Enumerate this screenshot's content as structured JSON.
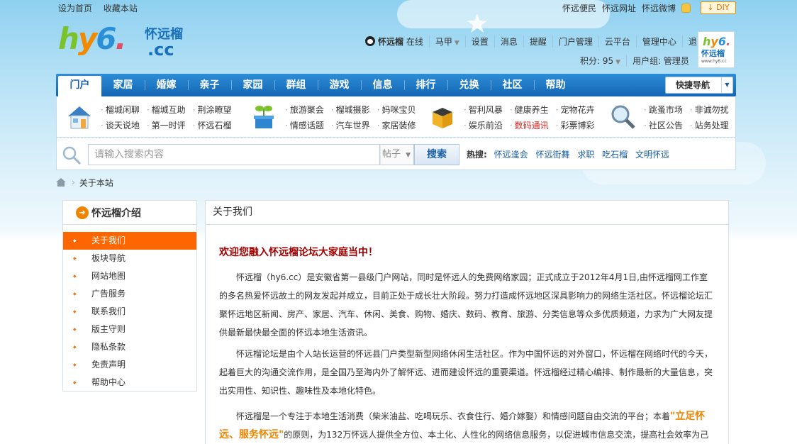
{
  "topbar": {
    "set_home": "设为首页",
    "bookmark": "收藏本站",
    "links": [
      "怀远便民",
      "怀远网址",
      "怀远微博"
    ],
    "diy": "DIY"
  },
  "logo": {
    "hy": [
      "h",
      "y",
      "6",
      "."
    ],
    "cn": "怀远榴",
    "cc": ".cc"
  },
  "user": {
    "name": "怀远榴",
    "status": "在线",
    "group_menu": "马甲",
    "links": [
      "设置",
      "消息",
      "提醒",
      "门户管理",
      "云平台",
      "管理中心",
      "退出"
    ],
    "points": "积分: 95",
    "usergroup": "用户组: 管理员",
    "avatar_site": "www.hy6.cc"
  },
  "nav": {
    "tabs": [
      "门户",
      "家居",
      "婚嫁",
      "亲子",
      "家园",
      "群组",
      "游戏",
      "信息",
      "排行",
      "兑换",
      "社区",
      "帮助"
    ],
    "quick": "快捷导航"
  },
  "subnav": [
    {
      "icon": "house-icon",
      "rows": [
        [
          "榴城闲聊",
          "榴城互助",
          "荆涂瞭望"
        ],
        [
          "谈天说地",
          "第一时评",
          "怀远石榴"
        ]
      ]
    },
    {
      "icon": "plant-icon",
      "rows": [
        [
          "旅游聚会",
          "榴城摄影",
          "妈咪宝贝"
        ],
        [
          "情感话题",
          "汽车世界",
          "家居装修"
        ]
      ]
    },
    {
      "icon": "box-icon",
      "rows": [
        [
          "智利风暴",
          "健康养生",
          "宠物花卉"
        ],
        [
          "娱乐前沿",
          "数码通讯",
          "彩票博彩"
        ]
      ]
    },
    {
      "icon": "magnifier-icon",
      "rows": [
        [
          "跳蚤市场",
          "非诚勿扰"
        ],
        [
          "社区公告",
          "站务处理"
        ]
      ]
    }
  ],
  "search": {
    "placeholder": "请输入搜索内容",
    "type": "帖子",
    "button": "搜索",
    "hot_label": "热搜:",
    "hot": [
      "怀远逢会",
      "怀远街舞",
      "求职",
      "吃石榴",
      "文明怀远"
    ]
  },
  "breadcrumb": {
    "current": "关于本站"
  },
  "sidebar": {
    "title": "怀远榴介绍",
    "items": [
      "关于我们",
      "板块导航",
      "网站地图",
      "广告服务",
      "联系我们",
      "版主守则",
      "隐私条款",
      "免责声明",
      "帮助中心"
    ]
  },
  "main": {
    "title": "关于我们",
    "welcome": "欢迎您融入怀远榴论坛大家庭当中！",
    "p1": "怀远榴（hy6.cc）是安徽省第一县级门户网站，同时是怀远人的免费网络家园；正式成立于2012年4月1日,由怀远榴网工作室的多名热爱怀远故土的网友发起并成立，目前正处于成长壮大阶段。努力打造成怀远地区深具影响力的网络生活社区。怀远榴论坛汇聚怀远地区新闻、房产、家居、汽车、休闲、美食、购物、婚庆、数码、教育、旅游、分类信息等众多优质频道，力求为广大网友提供最新最快最全面的怀远本地生活资讯。",
    "p2": "怀远榴论坛是由个人站长运营的怀远县门户类型新型网络休闲生活社区。作为中国怀远的对外窗口，怀远榴在网络时代的今天，起着巨大的沟通交流作用，是全国乃至海内外了解怀远、进而建设怀远的重要渠道。怀远榴经过精心编排、制作最新的大量信息，突出实用性、知识性、趣味性及本地化特色。",
    "p3_a": "怀远榴是一个专注于本地生活消费（柴米油盐、吃喝玩乐、衣食住行、婚介嫁娶）和情感问题自由交流的平台；本着",
    "p3_hl": "\"立足怀远、服务怀远\"",
    "p3_b": "的原则，为132万怀远人提供全方位、本土化、人性化的网络信息服务，以促进城市信息交流，提高社会效率为己"
  }
}
